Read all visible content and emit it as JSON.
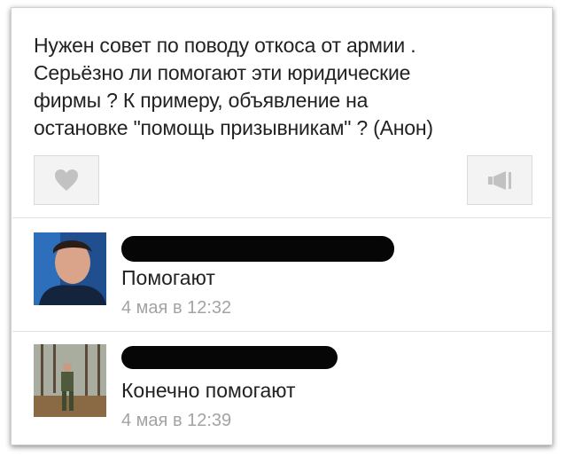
{
  "post": {
    "text": "Нужен совет по поводу откоса от армии .\nСерьёзно ли помогают эти юридические\nфирмы ? К примеру, объявление на\nостановке  \"помощь призывникам\" ? (Анон)",
    "like_icon": "heart-icon",
    "share_icon": "megaphone-icon"
  },
  "comments": [
    {
      "avatar": "user-avatar",
      "text": "Помогают",
      "time": "4 мая в 12:32"
    },
    {
      "avatar": "user-avatar",
      "text": "Конечно помогают",
      "time": "4 мая в 12:39"
    }
  ],
  "colors": {
    "text": "#222222",
    "muted": "#a3a3a3",
    "icon": "#c2c2c2",
    "button_bg": "#f3f3f3"
  }
}
